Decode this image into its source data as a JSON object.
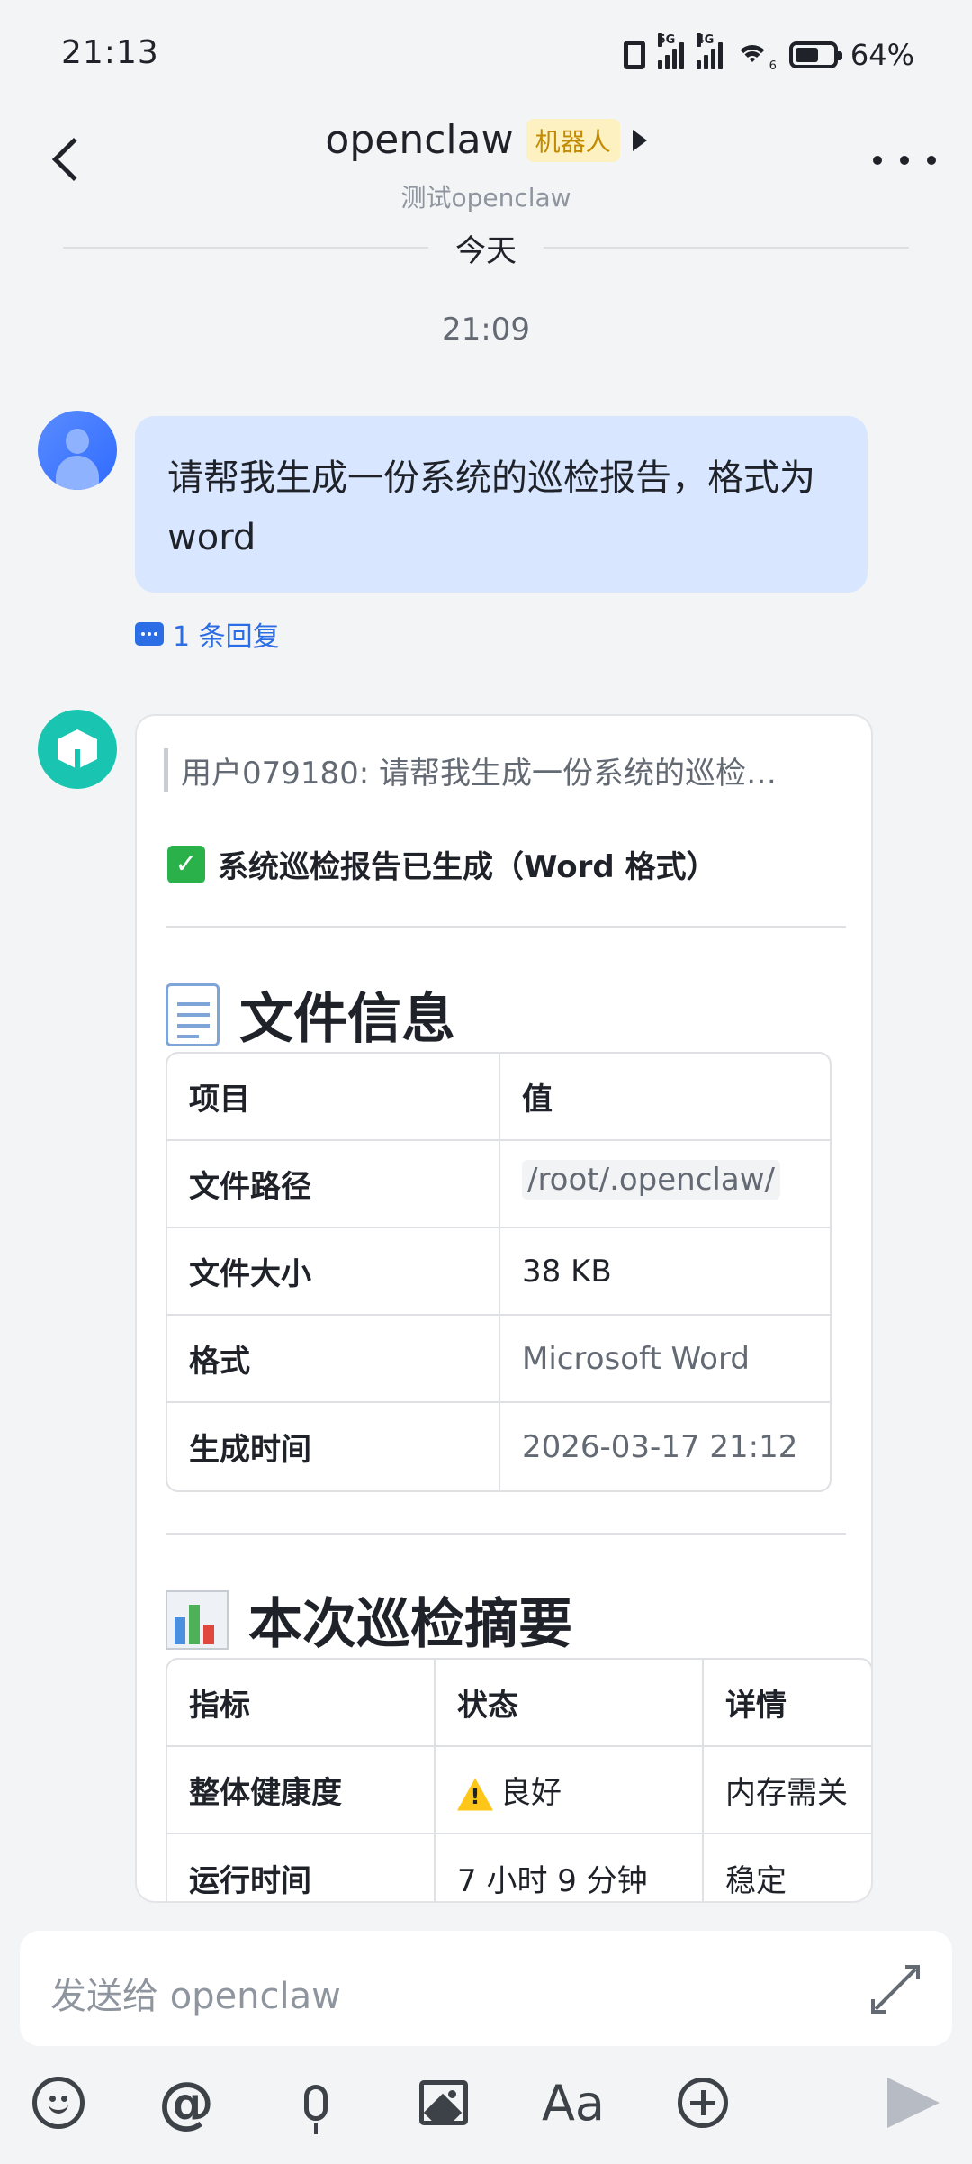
{
  "status_bar": {
    "time": "21:13",
    "net1": "5G",
    "net2": "4G",
    "wifi_badge": "6",
    "battery": "64%"
  },
  "header": {
    "title": "openclaw",
    "badge": "机器人",
    "subtitle": "测试openclaw"
  },
  "chat": {
    "date_divider": "今天",
    "timestamp": "21:09",
    "user_message": "请帮我生成一份系统的巡检报告，格式为word",
    "reply_count": "1 条回复",
    "bot": {
      "quote": "用户079180: 请帮我生成一份系统的巡检…",
      "done_text": "系统巡检报告已生成（Word 格式）",
      "file_section_title": "文件信息",
      "file_table": {
        "headers": [
          "项目",
          "值"
        ],
        "rows": [
          [
            "文件路径",
            "/root/.openclaw/"
          ],
          [
            "文件大小",
            "38 KB"
          ],
          [
            "格式",
            "Microsoft Word"
          ],
          [
            "生成时间",
            "2026-03-17 21:12"
          ]
        ]
      },
      "summary_section_title": "本次巡检摘要",
      "summary_table": {
        "headers": [
          "指标",
          "状态",
          "详情"
        ],
        "rows": [
          [
            "整体健康度",
            "良好",
            "内存需关"
          ],
          [
            "运行时间",
            "7 小时 9 分钟",
            "稳定"
          ]
        ]
      }
    }
  },
  "composer": {
    "placeholder": "发送给 openclaw",
    "font_tool_label": "Aa"
  },
  "colors": {
    "accent": "#2b6de5",
    "user_bubble": "#d8e6ff",
    "bot_avatar": "#19c5b0",
    "badge_bg": "#fdf1c2"
  }
}
